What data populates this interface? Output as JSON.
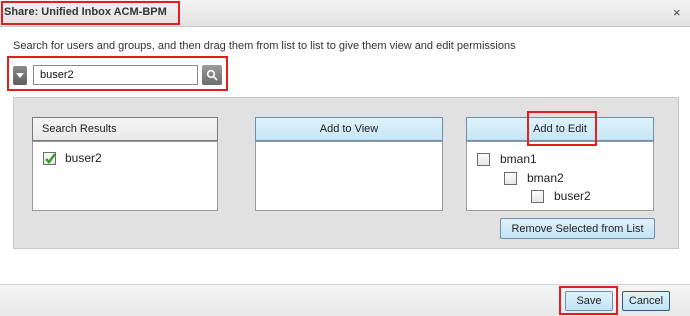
{
  "dialog": {
    "title": "Share: Unified Inbox ACM-BPM",
    "close_glyph": "×",
    "instructions": "Search for users and groups, and then drag them from list to list to give them view and edit permissions"
  },
  "search": {
    "value": "buser2",
    "dropdown_icon": "chevron-down-icon",
    "button_icon": "search-icon"
  },
  "columns": {
    "results": {
      "header": "Search Results",
      "items": [
        {
          "label": "buser2",
          "checked": true
        }
      ]
    },
    "view": {
      "header": "Add to View",
      "items": []
    },
    "edit": {
      "header": "Add to Edit",
      "tree": [
        {
          "label": "bman1",
          "level": 0,
          "checked": false
        },
        {
          "label": "bman2",
          "level": 1,
          "checked": false
        },
        {
          "label": "buser2",
          "level": 2,
          "checked": false
        }
      ]
    }
  },
  "remove_button": "Remove Selected from List",
  "footer": {
    "save": "Save",
    "cancel": "Cancel"
  },
  "colors": {
    "highlight": "#e02020",
    "button_blue": "#c6e6f5",
    "check_green": "#3a9a2a"
  }
}
